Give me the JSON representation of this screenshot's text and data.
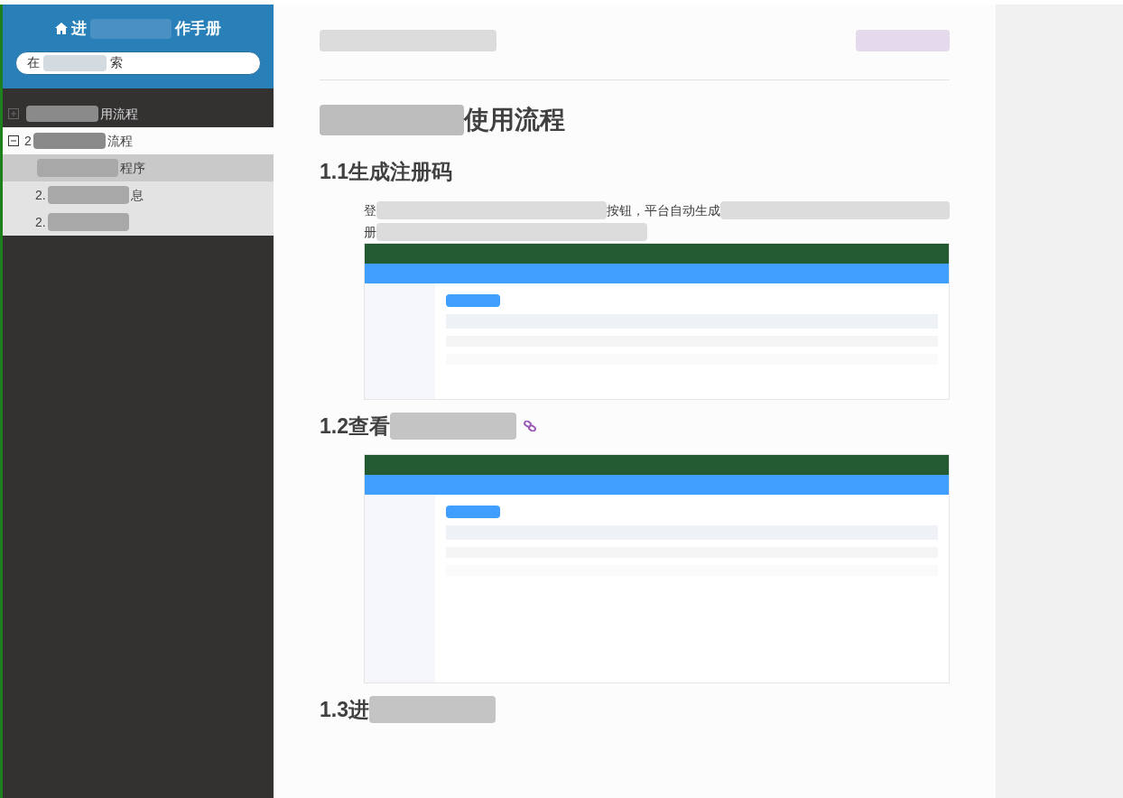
{
  "sidebar": {
    "title": [
      {
        "kind": "text",
        "text": "进"
      },
      {
        "kind": "redacted"
      },
      {
        "kind": "text",
        "text": "作手册"
      }
    ],
    "search": {
      "value": [
        {
          "kind": "text",
          "text": "在"
        },
        {
          "kind": "redacted"
        },
        {
          "kind": "text",
          "text": "索"
        }
      ]
    },
    "items": [
      {
        "expanded": false,
        "label": [
          {
            "kind": "redacted"
          },
          {
            "kind": "text",
            "text": "用流程"
          }
        ]
      },
      {
        "expanded": true,
        "label": [
          {
            "kind": "text",
            "text": "2"
          },
          {
            "kind": "redacted"
          },
          {
            "kind": "text",
            "text": "流程"
          }
        ],
        "children": [
          {
            "selected": true,
            "label": [
              {
                "kind": "redacted"
              },
              {
                "kind": "text",
                "text": "程序"
              }
            ]
          },
          {
            "selected": false,
            "label": [
              {
                "kind": "text",
                "text": "2."
              },
              {
                "kind": "redacted"
              },
              {
                "kind": "text",
                "text": "息"
              }
            ]
          },
          {
            "selected": false,
            "label": [
              {
                "kind": "text",
                "text": "2."
              },
              {
                "kind": "redacted"
              }
            ]
          }
        ]
      }
    ]
  },
  "content": {
    "blocks": [
      {
        "kind": "h1",
        "segments": [
          {
            "kind": "redacted"
          },
          {
            "kind": "text",
            "text": "使用流程"
          }
        ]
      },
      {
        "kind": "h2",
        "segments": [
          {
            "kind": "text",
            "text": "1.1生成注册码"
          }
        ]
      },
      {
        "kind": "p",
        "segments": [
          {
            "kind": "text",
            "text": "登"
          },
          {
            "kind": "redacted"
          },
          {
            "kind": "text",
            "text": "按钮，平台自动生成"
          },
          {
            "kind": "redacted"
          }
        ]
      },
      {
        "kind": "p",
        "segments": [
          {
            "kind": "text",
            "text": "册"
          },
          {
            "kind": "redacted"
          }
        ]
      },
      {
        "kind": "screenshot"
      },
      {
        "kind": "h2",
        "link": true,
        "segments": [
          {
            "kind": "text",
            "text": "1.2查看"
          },
          {
            "kind": "redacted"
          }
        ]
      },
      {
        "kind": "screenshot"
      },
      {
        "kind": "h2",
        "segments": [
          {
            "kind": "text",
            "text": "1.3进"
          },
          {
            "kind": "redacted"
          }
        ]
      }
    ]
  }
}
